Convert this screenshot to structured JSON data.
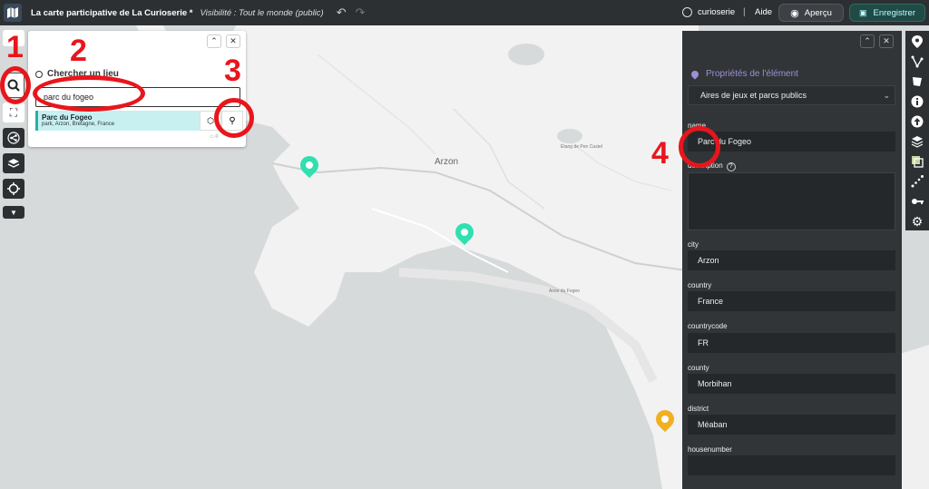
{
  "topbar": {
    "title": "La carte participative de La Curioserie *",
    "visibility": "Visibilité : Tout le monde (public)",
    "user": "curioserie",
    "separator": "|",
    "help": "Aide",
    "preview": "Aperçu",
    "save": "Enregistrer"
  },
  "map": {
    "town_label": "Arzon",
    "small_label_1": "Étang de Pen Castel",
    "small_label_2": "Anse du Fogeo"
  },
  "search": {
    "heading": "Chercher un lieu",
    "input_value": "parc du fogeo",
    "result_name": "Parc du Fogeo",
    "result_desc": "park, Arzon, Bretagne, France",
    "collapse_label": "⌃",
    "close_label": "✕"
  },
  "props": {
    "title": "Propriétés de l'élément",
    "layer_select": "Aires de jeux et parcs publics",
    "collapse_label": "⌃",
    "close_label": "✕",
    "fields": [
      {
        "label": "name",
        "value": "Parc du Fogeo"
      },
      {
        "label": "description",
        "value": ""
      },
      {
        "label": "city",
        "value": "Arzon"
      },
      {
        "label": "country",
        "value": "France"
      },
      {
        "label": "countrycode",
        "value": "FR"
      },
      {
        "label": "county",
        "value": "Morbihan"
      },
      {
        "label": "district",
        "value": "Méaban"
      },
      {
        "label": "housenumber",
        "value": ""
      }
    ]
  },
  "annotations": {
    "n1": "1",
    "n2": "2",
    "n3": "3",
    "n4": "4"
  },
  "colors": {
    "annotation_red": "#e8161c",
    "pin_green": "#2fe0b0",
    "pin_orange": "#f0b020",
    "title_purple": "#9d8fd6"
  }
}
